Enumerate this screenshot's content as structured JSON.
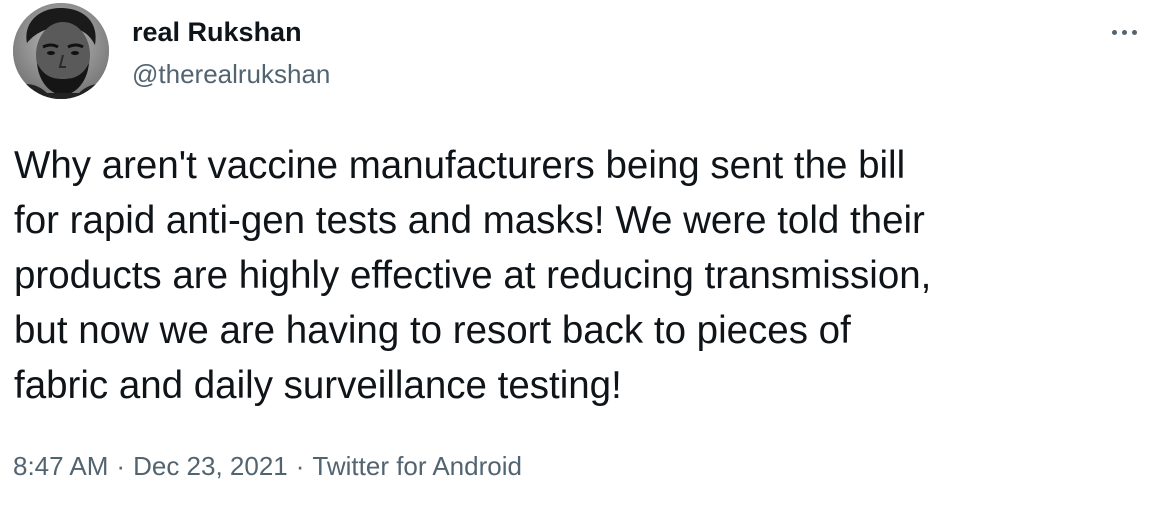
{
  "author": {
    "display_name": "real Rukshan",
    "handle": "@therealrukshan",
    "avatar_icon": "profile-photo-avatar"
  },
  "more_menu": {
    "icon": "more-horizontal-icon"
  },
  "tweet": {
    "lines": [
      "Why aren't vaccine manufacturers being sent the bill",
      "for rapid anti-gen tests and masks! We were told their",
      "products are highly effective at reducing transmission,",
      "but now we are having to resort back to pieces of",
      "fabric and daily surveillance testing!"
    ]
  },
  "meta": {
    "time": "8:47 AM",
    "separator": "·",
    "date": "Dec 23, 2021",
    "source": "Twitter for Android"
  },
  "colors": {
    "text_primary": "#0f1419",
    "text_secondary": "#536471",
    "background": "#ffffff"
  }
}
